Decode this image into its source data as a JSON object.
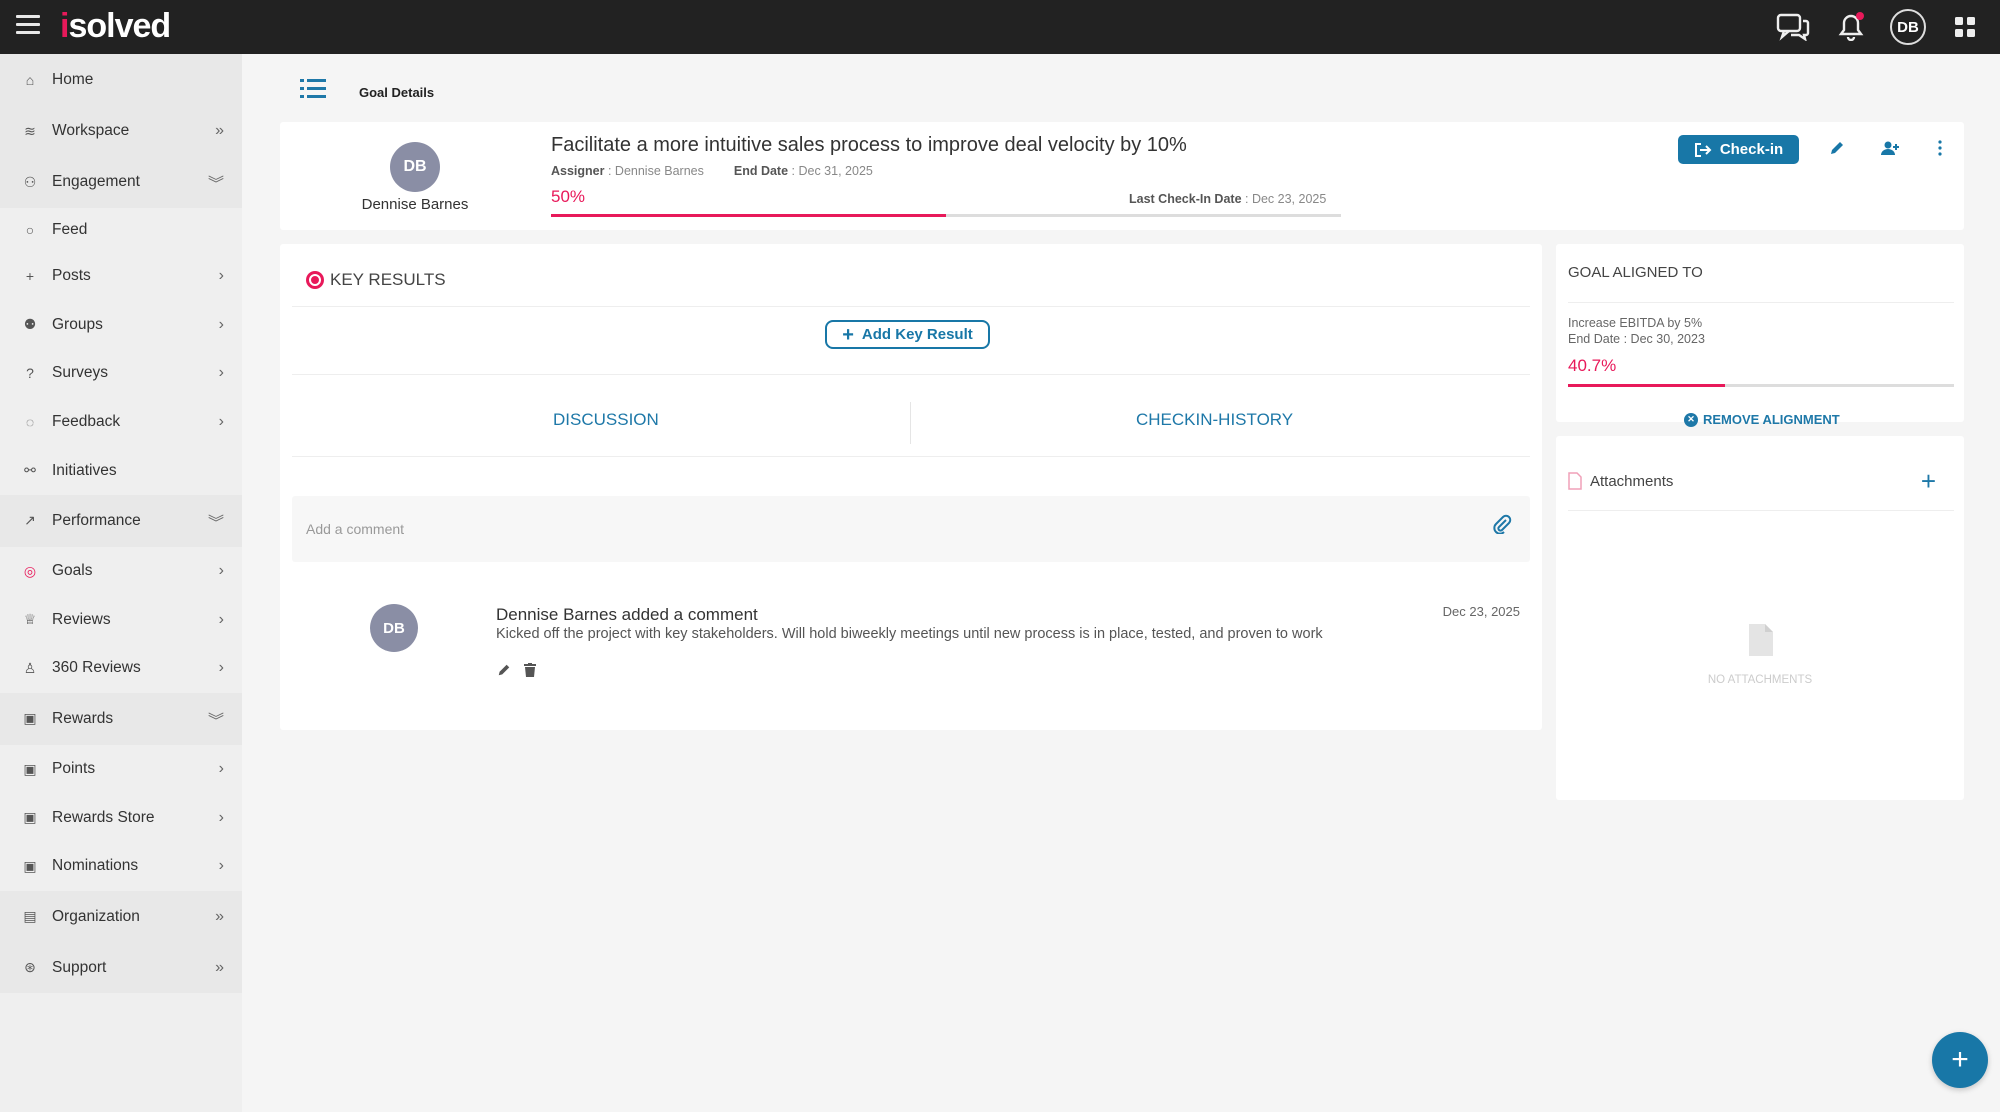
{
  "app": {
    "logo_text": "solved",
    "logo_prefix": "i"
  },
  "topbar": {
    "user_initials": "DB"
  },
  "sidebar": {
    "items": [
      {
        "label": "Home"
      },
      {
        "label": "Workspace"
      },
      {
        "label": "Engagement"
      },
      {
        "label": "Feed"
      },
      {
        "label": "Posts"
      },
      {
        "label": "Groups"
      },
      {
        "label": "Surveys"
      },
      {
        "label": "Feedback"
      },
      {
        "label": "Initiatives"
      },
      {
        "label": "Performance"
      },
      {
        "label": "Goals"
      },
      {
        "label": "Reviews"
      },
      {
        "label": "360 Reviews"
      },
      {
        "label": "Rewards"
      },
      {
        "label": "Points"
      },
      {
        "label": "Rewards Store"
      },
      {
        "label": "Nominations"
      },
      {
        "label": "Organization"
      },
      {
        "label": "Support"
      }
    ]
  },
  "header": {
    "title": "Goal Details"
  },
  "goal": {
    "owner_initials": "DB",
    "owner_name": "Dennise Barnes",
    "title": "Facilitate a more intuitive sales process to improve deal velocity by 10%",
    "assigner_label": "Assigner",
    "assigner_value": "Dennise Barnes",
    "end_date_label": "End Date",
    "end_date_value": "Dec 31, 2025",
    "percent_label": "50%",
    "progress": 0.5,
    "last_checkin_label": "Last Check-In Date",
    "last_checkin_value": "Dec 23, 2025",
    "checkin_button": "Check-in"
  },
  "key_results": {
    "title": "KEY RESULTS",
    "add_button": "Add Key Result"
  },
  "tabs": {
    "discussion": "DISCUSSION",
    "checkin_history": "CHECKIN-HISTORY"
  },
  "comment_input": {
    "placeholder": "Add a comment"
  },
  "comment": {
    "initials": "DB",
    "author_line": "Dennise Barnes added a comment",
    "text": "Kicked off the project with key stakeholders. Will hold biweekly meetings until new process is in place, tested, and proven to work",
    "date": "Dec 23, 2025"
  },
  "aligned": {
    "title": "GOAL ALIGNED TO",
    "goal_name": "Increase EBITDA by 5%",
    "end_date": "End Date : Dec 30, 2023",
    "percent_label": "40.7%",
    "progress": 0.407,
    "remove_label": "REMOVE ALIGNMENT"
  },
  "attachments": {
    "title": "Attachments",
    "empty_text": "NO ATTACHMENTS"
  },
  "colors": {
    "accent": "#1877a7",
    "brand_pink": "#e8195a",
    "topbar": "#222222"
  }
}
